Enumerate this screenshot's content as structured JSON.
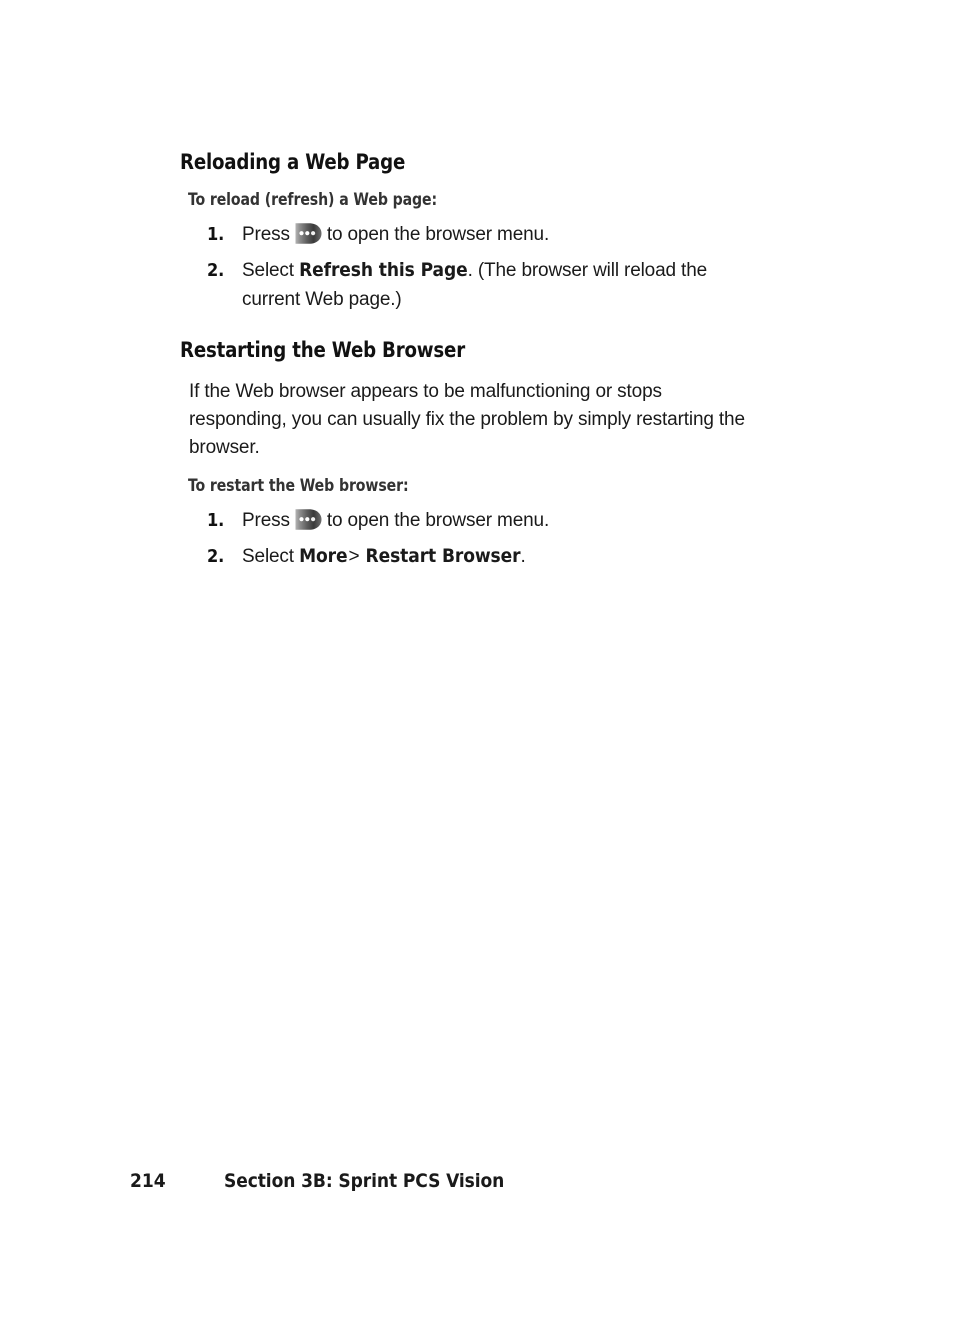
{
  "document": {
    "background_color": "#ffffff",
    "text_color": "#1a1a1a",
    "heading_color": "#111111",
    "subheading_color": "#333333"
  },
  "sections": [
    {
      "heading": "Reloading a Web Page",
      "subheading": "To reload (refresh) a Web page:",
      "steps": [
        {
          "number": "1.",
          "text_before_icon": "Press",
          "icon": "browser-menu-key-icon",
          "text_after_icon": "to open the browser menu."
        },
        {
          "number": "2.",
          "lead": "Select",
          "bold_term": "Refresh this Page",
          "trailing": ". (The browser will reload the current Web page.)"
        }
      ]
    },
    {
      "heading": "Restarting the Web Browser",
      "paragraph": "If the Web browser appears to be malfunctioning or stops responding, you can usually fix the problem by simply restarting the browser.",
      "subheading": "To restart the Web browser:",
      "steps": [
        {
          "number": "1.",
          "text_before_icon": "Press",
          "icon": "browser-menu-key-icon",
          "text_after_icon": "to open the browser menu."
        },
        {
          "number": "2.",
          "lead": "Select",
          "bold_term": "More",
          "separator": ">",
          "bold_term_2": "Restart Browser",
          "trailing": "."
        }
      ]
    }
  ],
  "footer": {
    "page_number": "214",
    "section_label": "Section 3B: Sprint PCS Vision"
  },
  "icons": {
    "browser_menu_key": {
      "name": "browser-menu-key-icon",
      "description": "three-dot phone menu soft key",
      "dot_color": "#ffffff",
      "body_color_light": "#8e8e8e",
      "body_color_dark": "#2e2e2e"
    }
  }
}
